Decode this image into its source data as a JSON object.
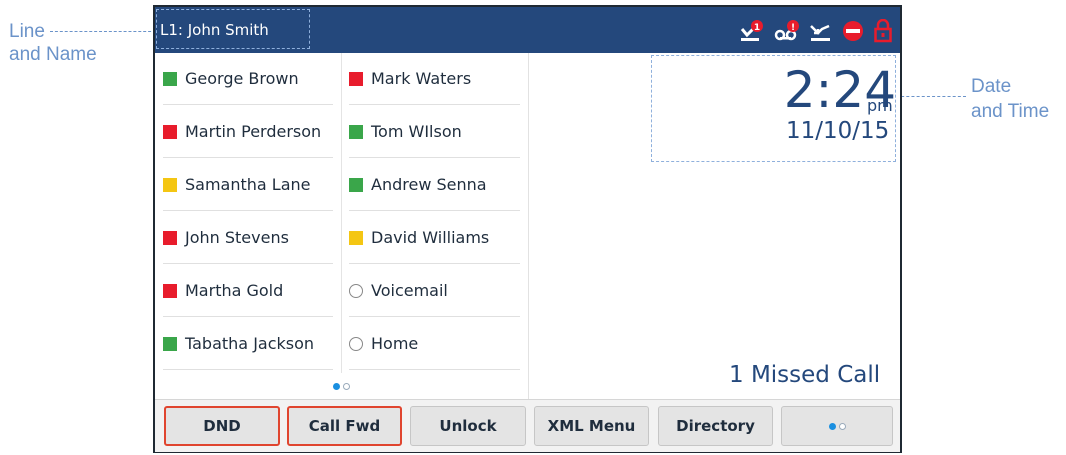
{
  "callouts": {
    "line_name_1": "Line",
    "line_name_2": "and Name",
    "date_time_1": "Date",
    "date_time_2": "and Time"
  },
  "header": {
    "line_label": "L1: John Smith",
    "icons": [
      "missed-calls-badge-icon",
      "voicemail-alert-icon",
      "call-forward-icon",
      "dnd-icon",
      "lock-icon"
    ],
    "badge_count": "1",
    "badge_alert": "!"
  },
  "contacts": {
    "left": [
      {
        "name": "George Brown",
        "status": "available"
      },
      {
        "name": "Martin Perderson",
        "status": "busy"
      },
      {
        "name": "Samantha Lane",
        "status": "away"
      },
      {
        "name": "John Stevens",
        "status": "busy"
      },
      {
        "name": "Martha Gold",
        "status": "busy"
      },
      {
        "name": "Tabatha Jackson",
        "status": "available"
      }
    ],
    "right": [
      {
        "name": "Mark Waters",
        "status": "busy"
      },
      {
        "name": "Tom WIlson",
        "status": "available"
      },
      {
        "name": "Andrew Senna",
        "status": "available"
      },
      {
        "name": "David Williams",
        "status": "away"
      },
      {
        "name": "Voicemail",
        "status": "speed-dial"
      },
      {
        "name": "Home",
        "status": "speed-dial"
      }
    ],
    "page": 1,
    "pages": 2
  },
  "colors": {
    "available": "#3aa64a",
    "busy": "#e81c2c",
    "away": "#f4c613",
    "header": "#24487c",
    "accent": "#1a8fe0"
  },
  "clock": {
    "time": "2:24",
    "ampm": "pm",
    "date": "11/10/15"
  },
  "missed": "1  Missed Call",
  "softkeys": [
    {
      "label": "DND",
      "active": true
    },
    {
      "label": "Call Fwd",
      "active": true
    },
    {
      "label": "Unlock",
      "active": false
    },
    {
      "label": "XML Menu",
      "active": false
    },
    {
      "label": "Directory",
      "active": false
    },
    {
      "label": "",
      "active": false
    }
  ]
}
